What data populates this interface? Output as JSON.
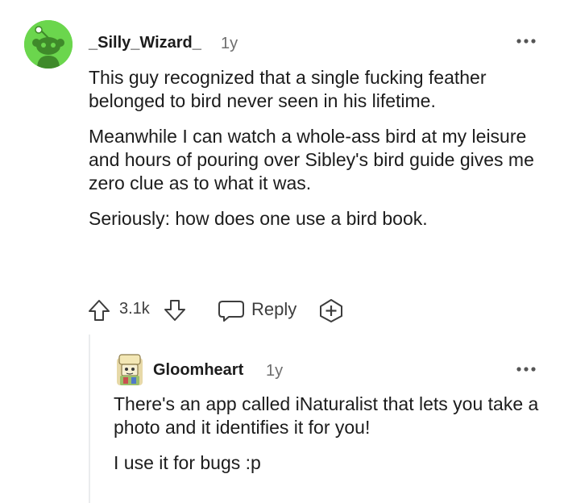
{
  "comment": {
    "username": "_Silly_Wizard_",
    "age": "1y",
    "paragraphs": [
      "This guy recognized that a single fucking feather belonged to bird never seen in his lifetime.",
      "Meanwhile I can watch a whole-ass bird at my leisure and hours of pouring over Sibley's bird guide gives me zero clue as to what it was.",
      "Seriously: how does one use a bird book."
    ],
    "score": "3.1k",
    "reply_label": "Reply",
    "icons": [
      "more-icon",
      "upvote-icon",
      "downvote-icon",
      "comment-icon",
      "award-icon"
    ],
    "avatar_color": "#6bd64d"
  },
  "reply": {
    "username": "Gloomheart",
    "age": "1y",
    "paragraphs": [
      "There's an app called iNaturalist that lets you take a photo and it identifies it for you!",
      "I use it for bugs :p"
    ]
  }
}
